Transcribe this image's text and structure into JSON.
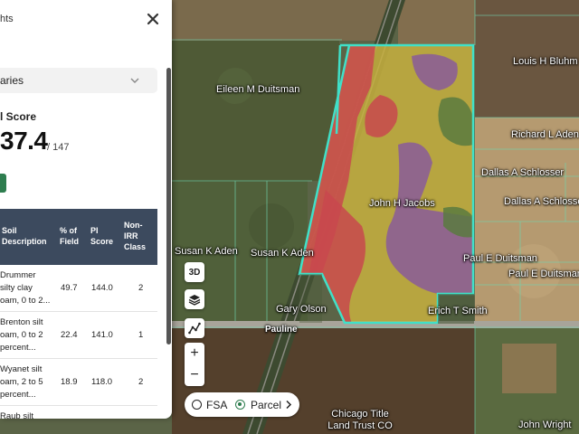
{
  "panel": {
    "title": "hts",
    "dropdown_value": "aries",
    "score_label": "l Score",
    "score_value": "37.4",
    "score_total": "/ 147",
    "table": {
      "headers": [
        "Soil Description",
        "% of Field",
        "PI Score",
        "Non-IRR Class"
      ],
      "rows": [
        {
          "desc": [
            "Drummer",
            "silty clay",
            "oam, 0 to 2..."
          ],
          "pct": "49.7",
          "pi": "144.0",
          "cls": "2"
        },
        {
          "desc": [
            "Brenton silt",
            "oam, 0 to 2",
            "percent..."
          ],
          "pct": "22.4",
          "pi": "141.0",
          "cls": "1"
        },
        {
          "desc": [
            "Wyanet silt",
            "oam, 2 to 5",
            "percent..."
          ],
          "pct": "18.9",
          "pi": "118.0",
          "cls": "2"
        },
        {
          "desc": [
            "Raub silt"
          ],
          "pct": "",
          "pi": "",
          "cls": ""
        }
      ]
    }
  },
  "map": {
    "owners": [
      "Eileen M Duitsman",
      "Louis H Bluhm",
      "Richard L Aden",
      "Dallas A Schlosser",
      "Dallas A Schlosser",
      "John H Jacobs",
      "Susan K Aden",
      "Susan K Aden",
      "Paul E Duitsman",
      "Paul E Duitsman",
      "Gary Olson",
      "Erich T Smith",
      "John Wright"
    ],
    "road": "Pauline",
    "trust": [
      "Chicago Title",
      "Land Trust CO"
    ]
  },
  "controls": {
    "btn_3d": "3D",
    "zoom_in": "+",
    "zoom_out": "−",
    "radio_fsa": "FSA",
    "radio_parcel": "Parcel"
  },
  "colors": {
    "boundary": "#40e0c8",
    "soil_yellow": "#c8b040",
    "soil_red": "#c8484e",
    "soil_purple": "#8a5a9a",
    "soil_green": "#5a7a40",
    "panel_header": "#3c4a5e",
    "accent": "#2e7d4f"
  }
}
